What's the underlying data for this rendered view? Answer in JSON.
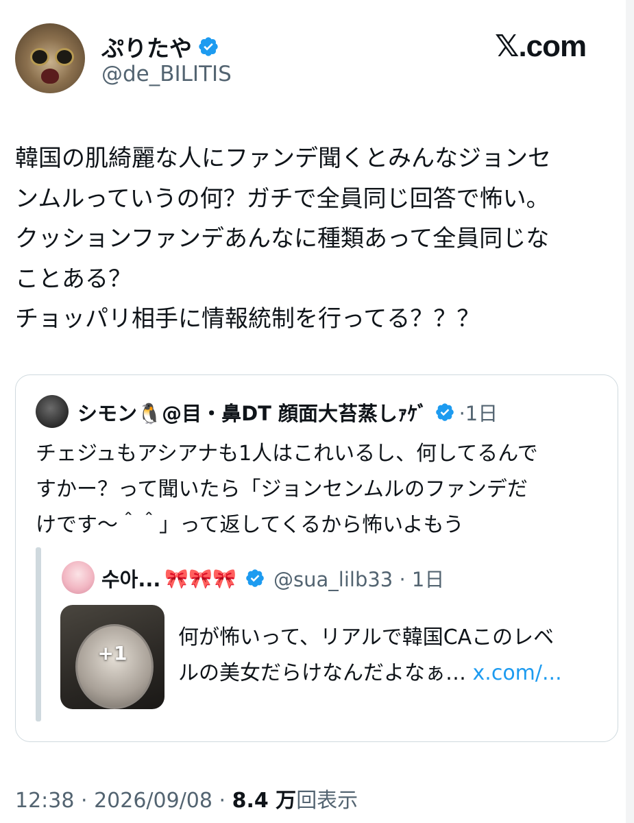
{
  "author": {
    "display_name": "ぷりたや",
    "handle": "@de_BILITIS",
    "verified": true
  },
  "site_logo": "𝕏.com",
  "post": {
    "text": "韓国の肌綺麗な人にファンデ聞くとみんなジョンセ\nンムルっていうの何？ガチで全員同じ回答で怖い。\nクッションファンデあんなに種類あって全員同じな\nことある？\nチョッパリ相手に情報統制を行ってる？？？"
  },
  "quoted": {
    "display_name": "シモン🐧@目・鼻DT 顔面大苔蒸しｧｹﾞ",
    "time": "·1日",
    "text": "チェジュもアシアナも1人はこれいるし、何してるんで\nすかー？って聞いたら「ジョンセンムルのファンデだ\nけです〜＾＾」って返してくるから怖いよもう",
    "nested": {
      "display_name": "수아...",
      "bows": "🎀🎀🎀",
      "handle_time": "@sua_lilb33 · 1日",
      "media_count": "+1",
      "text": "何が怖いって、リアルで韓国CAこのレベ\nルの美女だらけなんだよなぁ… ",
      "link": "x.com/..."
    }
  },
  "footer": {
    "time": "12:38 · 2026/09/08 · ",
    "views_number": "8.4 万",
    "views_label": "回表示"
  },
  "colors": {
    "accent": "#1d9bf0",
    "muted": "#536471",
    "text": "#0f1419",
    "border": "#cfd9de"
  }
}
